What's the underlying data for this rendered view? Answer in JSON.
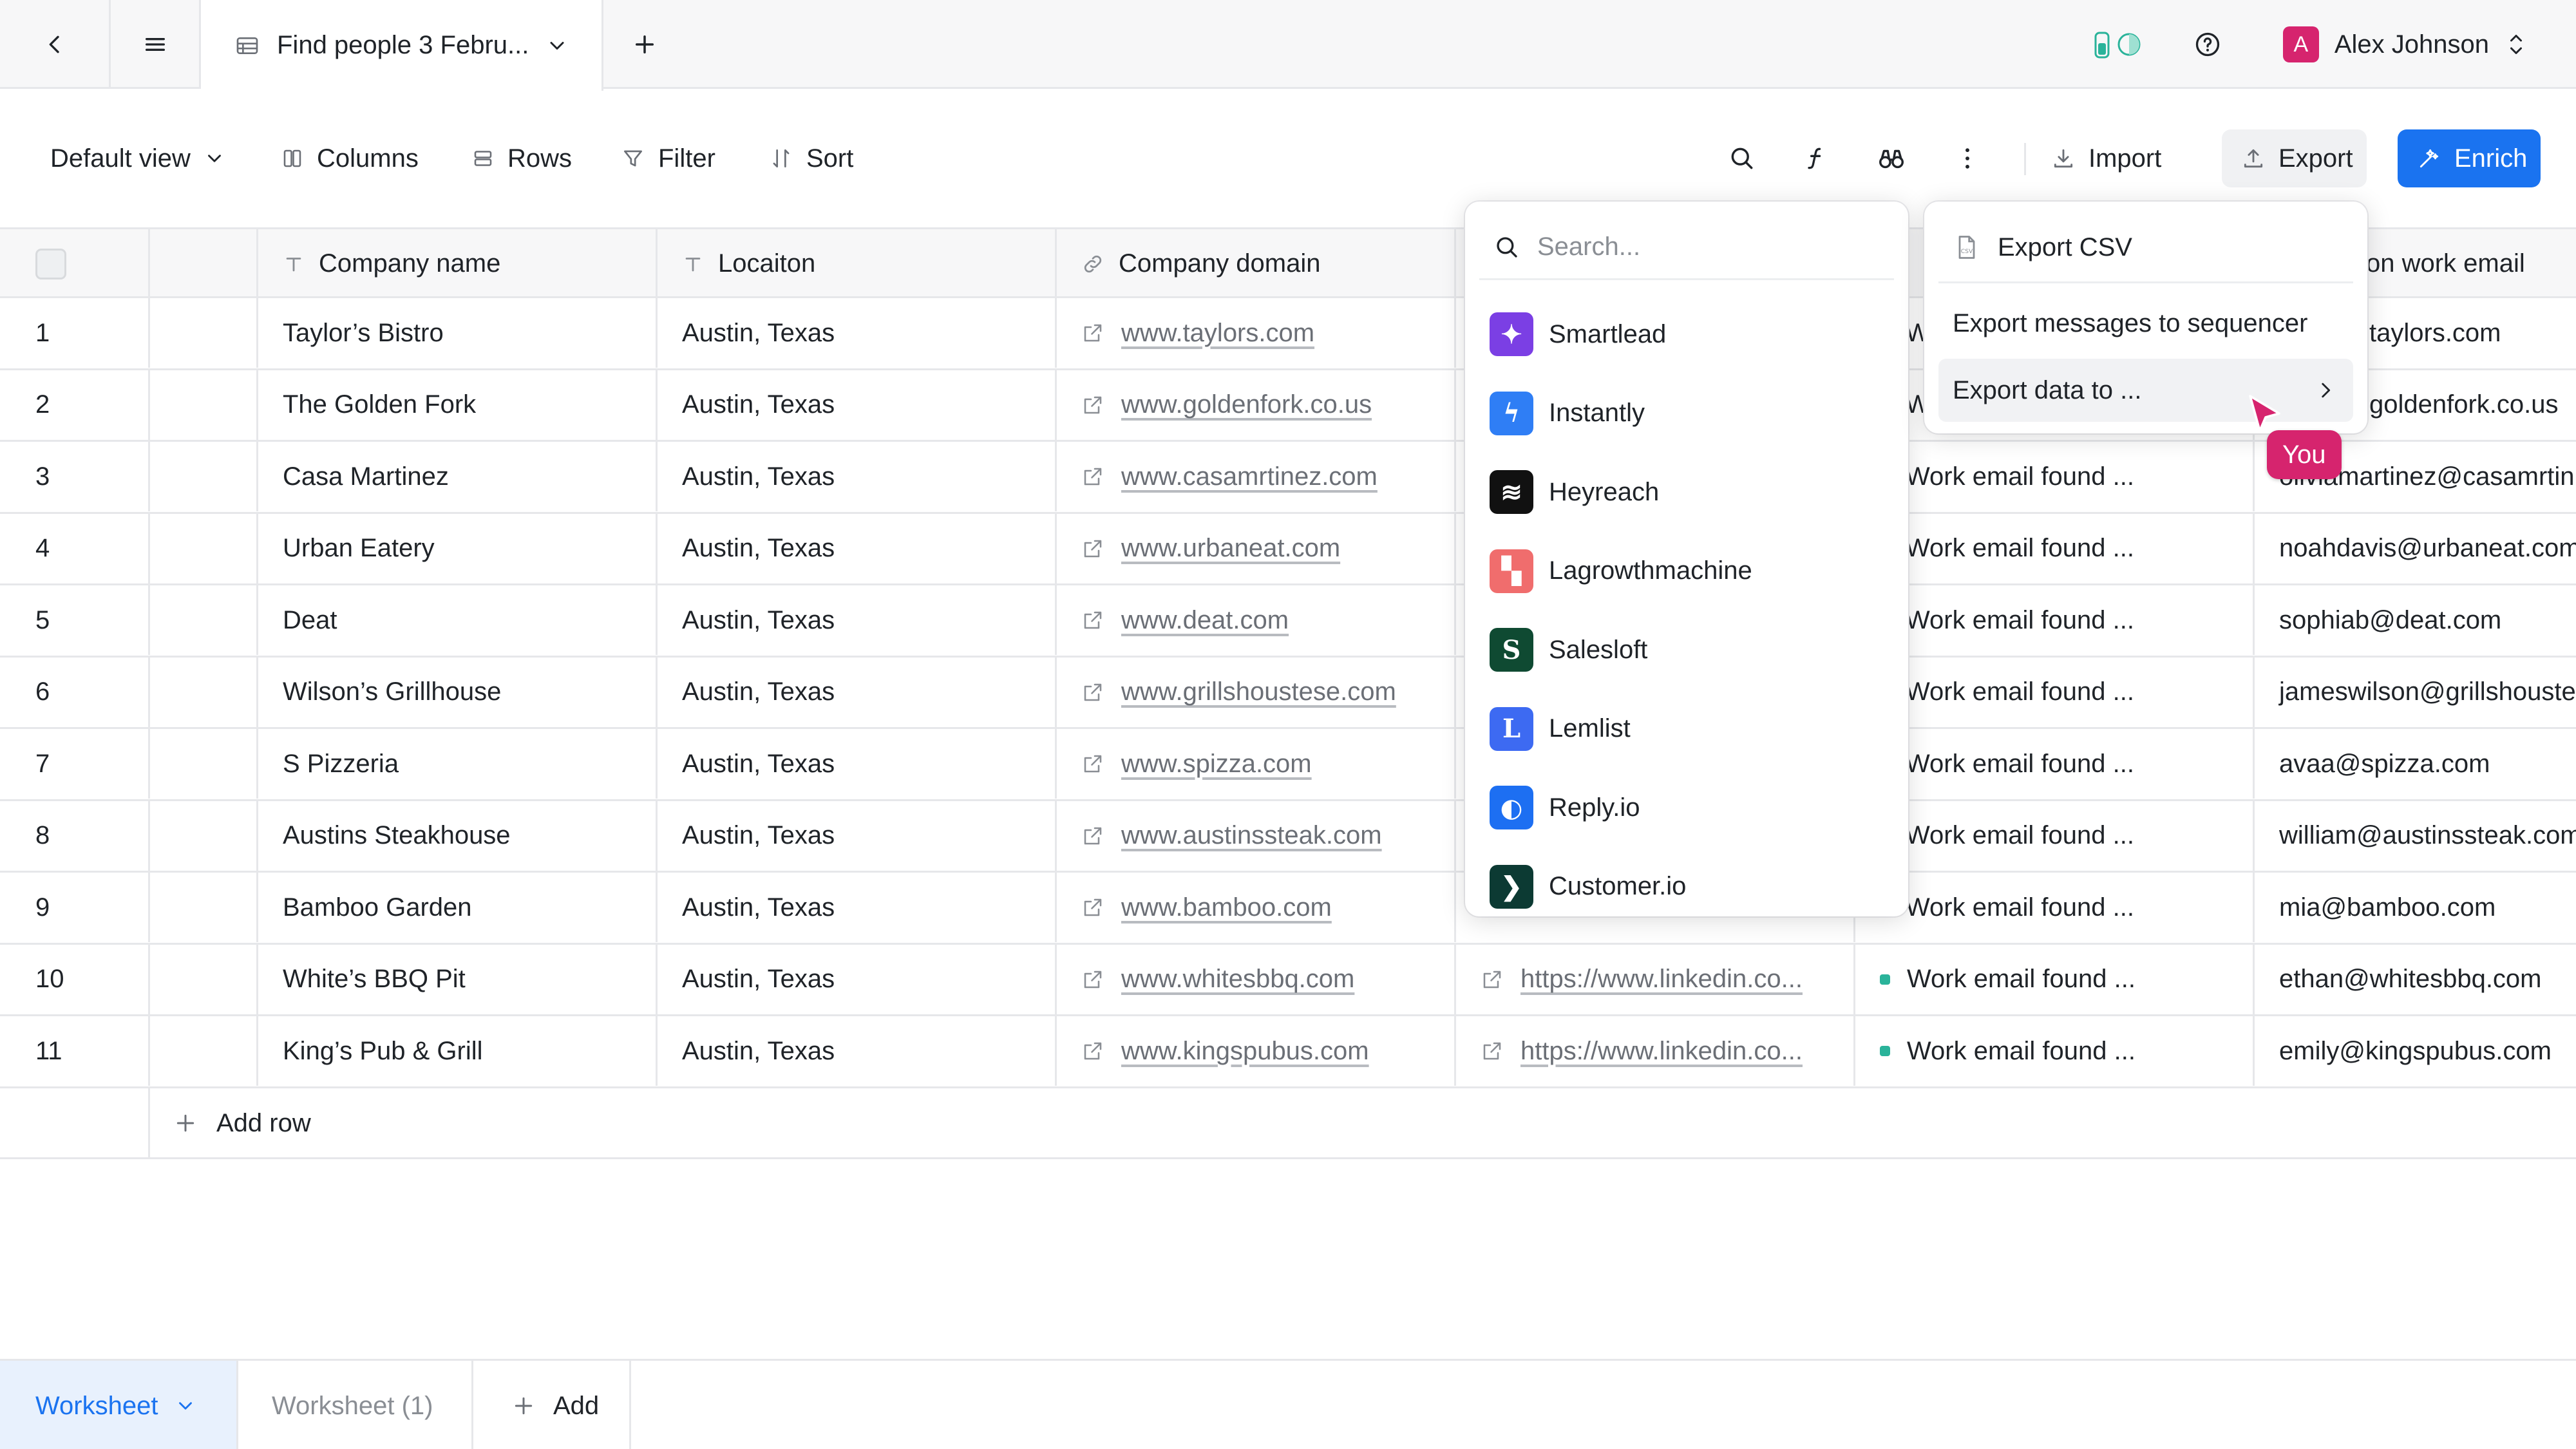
{
  "topbar": {
    "tab_title": "Find people 3 Febru...",
    "user_initial": "A",
    "user_name": "Alex Johnson"
  },
  "toolbar": {
    "view_label": "Default view",
    "columns_label": "Columns",
    "rows_label": "Rows",
    "filter_label": "Filter",
    "sort_label": "Sort",
    "import_label": "Import",
    "export_label": "Export",
    "enrich_label": "Enrich"
  },
  "table": {
    "headers": {
      "company_name": "Company name",
      "location": "Locaiton",
      "company_domain": "Company domain",
      "work_email": "on work email"
    },
    "rows": [
      {
        "num": "1",
        "company": "Taylor’s Bistro",
        "location": "Austin, Texas",
        "domain": "www.taylors.com",
        "linkedin": "",
        "status": "W",
        "email": "taylors.com"
      },
      {
        "num": "2",
        "company": "The Golden Fork",
        "location": "Austin, Texas",
        "domain": "www.goldenfork.co.us",
        "linkedin": "",
        "status": "W",
        "email": "goldenfork.co.us"
      },
      {
        "num": "3",
        "company": "Casa Martinez",
        "location": "Austin, Texas",
        "domain": "www.casamrtinez.com",
        "linkedin": "",
        "status": "Work email found ...",
        "email": "oliviamartinez@casamrtin"
      },
      {
        "num": "4",
        "company": "Urban Eatery",
        "location": "Austin, Texas",
        "domain": "www.urbaneat.com",
        "linkedin": "",
        "status": "Work email found ...",
        "email": "noahdavis@urbaneat.com"
      },
      {
        "num": "5",
        "company": "Deat",
        "location": "Austin, Texas",
        "domain": "www.deat.com",
        "linkedin": "",
        "status": "Work email found ...",
        "email": "sophiab@deat.com"
      },
      {
        "num": "6",
        "company": "Wilson’s Grillhouse",
        "location": "Austin, Texas",
        "domain": "www.grillshoustese.com",
        "linkedin": "",
        "status": "Work email found ...",
        "email": "jameswilson@grillshouste"
      },
      {
        "num": "7",
        "company": "S Pizzeria",
        "location": "Austin, Texas",
        "domain": "www.spizza.com",
        "linkedin": "",
        "status": "Work email found ...",
        "email": "avaa@spizza.com"
      },
      {
        "num": "8",
        "company": "Austins Steakhouse",
        "location": "Austin, Texas",
        "domain": "www.austinssteak.com",
        "linkedin": "",
        "status": "Work email found ...",
        "email": "william@austinssteak.com"
      },
      {
        "num": "9",
        "company": "Bamboo Garden",
        "location": "Austin, Texas",
        "domain": "www.bamboo.com",
        "linkedin": "",
        "status": "Work email found ...",
        "email": "mia@bamboo.com"
      },
      {
        "num": "10",
        "company": "White’s BBQ Pit",
        "location": "Austin, Texas",
        "domain": "www.whitesbbq.com",
        "linkedin": "https://www.linkedin.co...",
        "status": "Work email found ...",
        "email": "ethan@whitesbbq.com"
      },
      {
        "num": "11",
        "company": "King’s Pub & Grill",
        "location": "Austin, Texas",
        "domain": "www.kingspubus.com",
        "linkedin": "https://www.linkedin.co...",
        "status": "Work email found ...",
        "email": "emily@kingspubus.com"
      }
    ],
    "add_row_label": "Add row"
  },
  "integrations_menu": {
    "search_placeholder": "Search...",
    "items": [
      {
        "label": "Smartlead",
        "color": "#7b3fe4"
      },
      {
        "label": "Instantly",
        "color": "#2f7ef5"
      },
      {
        "label": "Heyreach",
        "color": "#111111"
      },
      {
        "label": "Lagrowthmachine",
        "color": "#f06d6d"
      },
      {
        "label": "Salesloft",
        "color": "#0f4a32"
      },
      {
        "label": "Lemlist",
        "color": "#3d6af2"
      },
      {
        "label": "Reply.io",
        "color": "#1d6ff2"
      },
      {
        "label": "Customer.io",
        "color": "#0c3a33"
      }
    ]
  },
  "export_menu": {
    "items": [
      "Export CSV",
      "Export messages to sequencer",
      "Export data to ..."
    ],
    "csv_tag": "CSV"
  },
  "cursor": {
    "label": "You",
    "color": "#d6246e"
  },
  "bottom_tabs": {
    "active": "Worksheet",
    "second": "Worksheet (1)",
    "add": "Add"
  },
  "colors": {
    "accent": "#1a73f0",
    "status_dot": "#2ab39a",
    "user": "#d6246e"
  }
}
